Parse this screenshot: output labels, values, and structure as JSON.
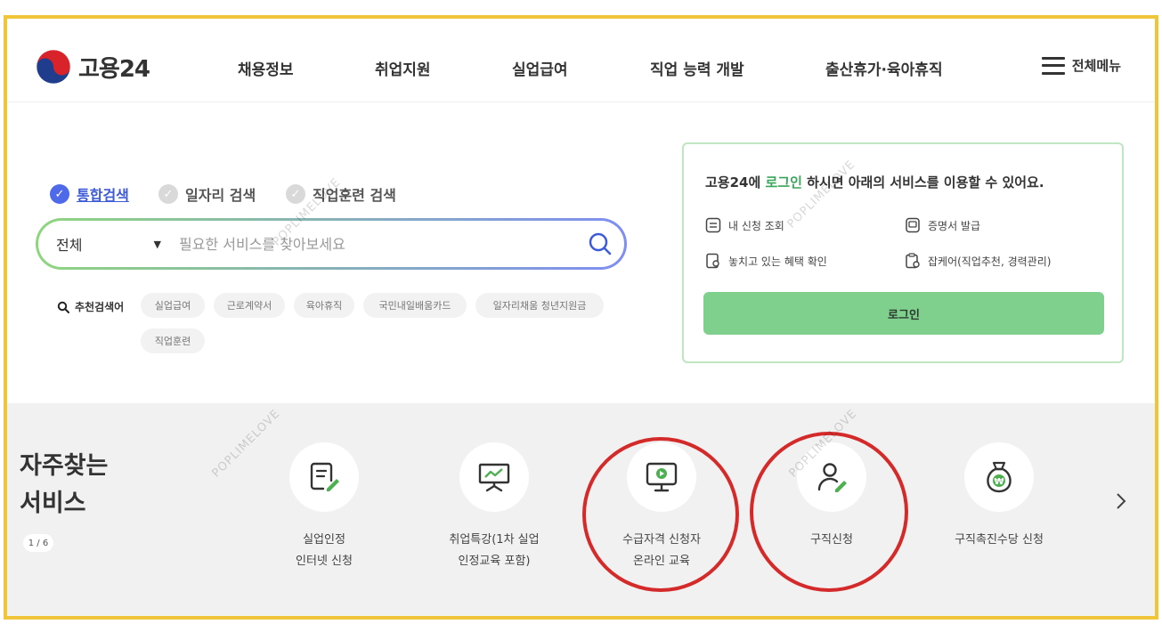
{
  "header": {
    "logo_text": "고용24",
    "nav": [
      "채용정보",
      "취업지원",
      "실업급여",
      "직업 능력 개발",
      "출산휴가·육아휴직"
    ],
    "menu_all": "전체메뉴"
  },
  "search": {
    "tabs": [
      "통합검색",
      "일자리 검색",
      "직업훈련 검색"
    ],
    "active_tab": "통합검색",
    "scope": "전체",
    "placeholder": "필요한 서비스를 찾아보세요",
    "value": "",
    "recommend_label": "추천검색어",
    "recommend": [
      "실업급여",
      "근로계약서",
      "육아휴직",
      "국민내일배움카드",
      "일자리채움 청년지원금",
      "직업훈련"
    ]
  },
  "login_box": {
    "message_pre": "고용24에 ",
    "message_hl": "로그인",
    "message_post": " 하시면 아래의 서비스를 이용할 수 있어요.",
    "services": [
      "내 신청 조회",
      "증명서 발급",
      "놓치고 있는 혜택 확인",
      "잡케어(직업추천, 경력관리)"
    ],
    "login_button": "로그인"
  },
  "frequent": {
    "title_line1": "자주찾는",
    "title_line2": "서비스",
    "pager": "1 / 6",
    "items": [
      {
        "label": "실업인정\n인터넷 신청",
        "icon": "document-edit-icon"
      },
      {
        "label": "취업특강(1차 실업\n인정교육 포함)",
        "icon": "presentation-board-icon"
      },
      {
        "label": "수급자격 신청자\n온라인 교육",
        "icon": "monitor-play-icon"
      },
      {
        "label": "구직신청",
        "icon": "person-edit-icon"
      },
      {
        "label": "구직촉진수당 신청",
        "icon": "money-bag-won-icon"
      }
    ]
  },
  "watermark": "POPLIMELOVE",
  "colors": {
    "frame": "#f0c53a",
    "accent_blue": "#4f6ae8",
    "login_green": "#7fd08d",
    "highlight_green": "#3aa65a",
    "annotation_red": "#d42a2a"
  }
}
